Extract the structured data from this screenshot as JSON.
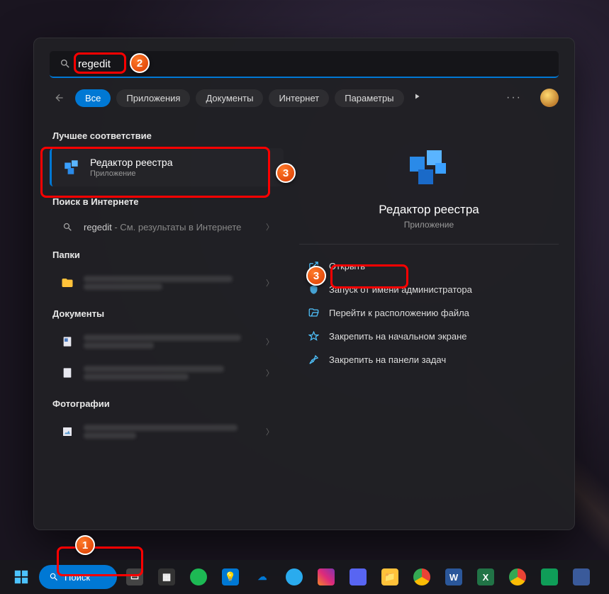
{
  "search": {
    "query": "regedit"
  },
  "filters": {
    "all": "Все",
    "apps": "Приложения",
    "docs": "Документы",
    "web": "Интернет",
    "settings": "Параметры"
  },
  "sections": {
    "best": "Лучшее соответствие",
    "web": "Поиск в Интернете",
    "folders": "Папки",
    "documents": "Документы",
    "photos": "Фотографии"
  },
  "best_match": {
    "title": "Редактор реестра",
    "subtitle": "Приложение"
  },
  "web_result": {
    "query": "regedit",
    "suffix": " - См. результаты в Интернете"
  },
  "preview": {
    "title": "Редактор реестра",
    "subtitle": "Приложение"
  },
  "actions": {
    "open": "Открыть",
    "admin": "Запуск от имени администратора",
    "location": "Перейти к расположению файла",
    "pin_start": "Закрепить на начальном экране",
    "pin_taskbar": "Закрепить на панели задач"
  },
  "taskbar": {
    "search": "Поиск"
  },
  "annotations": {
    "n1": "1",
    "n2": "2",
    "n3": "3"
  }
}
